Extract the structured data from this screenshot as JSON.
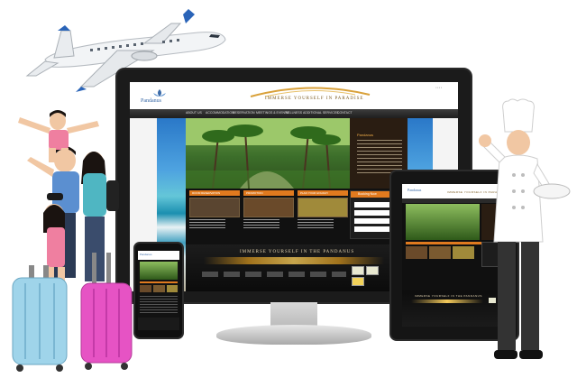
{
  "site": {
    "brand": "Pandanus",
    "slogan": "IMMERSE YOURSELF IN PARADISE",
    "footer_slogan": "IMMERSE YOURSELF IN THE PANDANUS",
    "booking_title": "Booking Now",
    "nav_items": [
      "ABOUT US",
      "ACCOMMODATION",
      "RESERVATION",
      "MEETINGS & EVENTS",
      "WELLNESS",
      "ADDITIONAL SERVICES",
      "CONTACT"
    ],
    "promo_headers": [
      "ROOM RESERVATION",
      "PROMOTION",
      "PLAN YOUR HOLIDAY"
    ],
    "colors": {
      "accent": "#e07a1f",
      "dark": "#111111",
      "brand_blue": "#3a6aa8"
    }
  },
  "illustration": {
    "airplane": "airplane-icon",
    "family": "family-with-luggage",
    "chef": "chef-figure"
  }
}
